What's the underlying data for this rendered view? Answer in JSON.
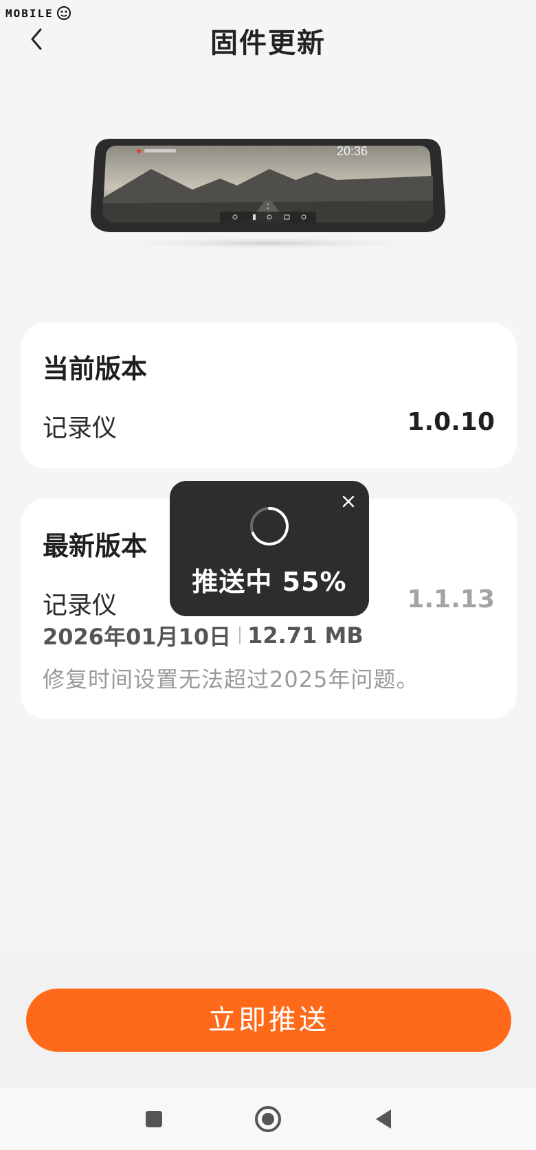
{
  "watermark": {
    "text": "MOBILE"
  },
  "header": {
    "title": "固件更新",
    "back_icon": "chevron-left-icon"
  },
  "device": {
    "screen_time": "20:36"
  },
  "current_version": {
    "title": "当前版本",
    "device_label": "记录仪",
    "version": "1.0.10"
  },
  "latest_version": {
    "title": "最新版本",
    "device_label": "记录仪",
    "version": "1.1.13",
    "date": "2026年01月10日",
    "size": "12.71 MB",
    "notes": "修复时间设置无法超过2025年问题。"
  },
  "toast": {
    "text": "推送中 55%",
    "progress": 0.55
  },
  "footer": {
    "push_button": "立即推送"
  },
  "colors": {
    "accent": "#ff6a1a",
    "toast_bg": "#2d2d2d",
    "page_bg": "#f5f5f5"
  },
  "nav": {
    "icons": [
      "square-icon",
      "home-circle-icon",
      "back-triangle-icon"
    ]
  }
}
